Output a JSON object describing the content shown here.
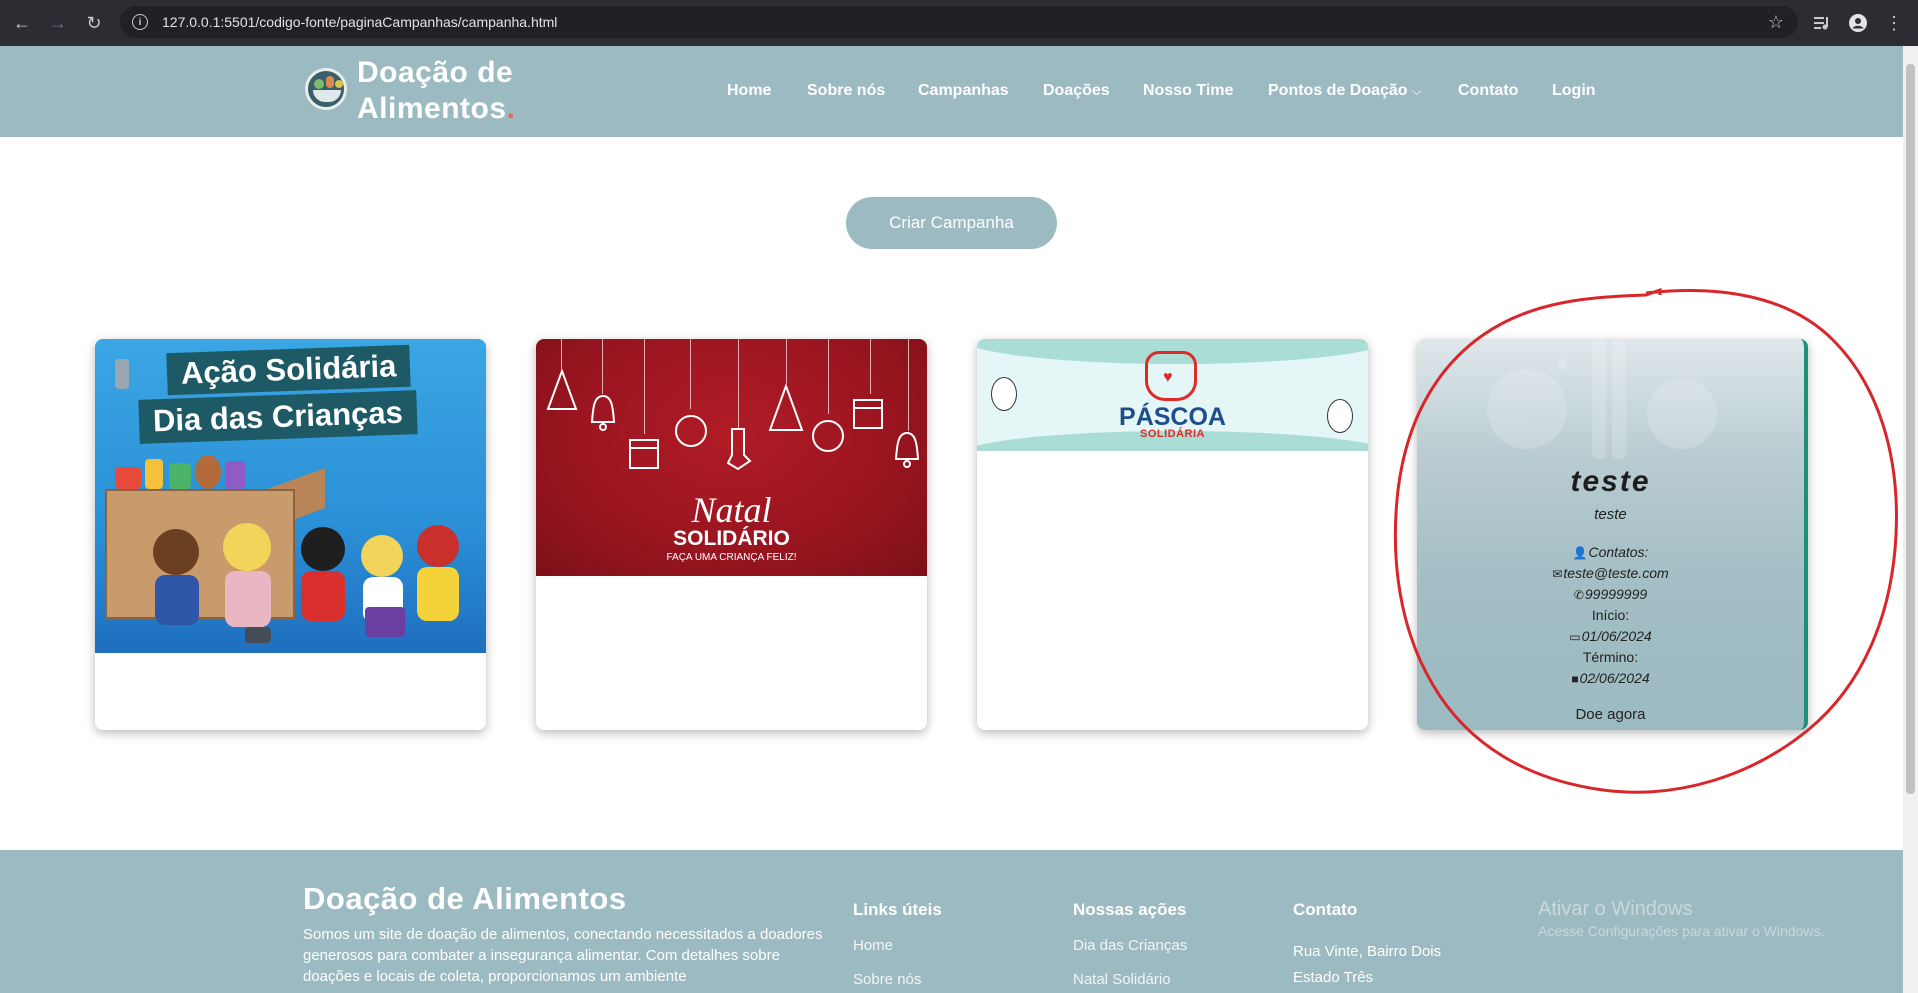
{
  "browser": {
    "url": "127.0.0.1:5501/codigo-fonte/paginaCampanhas/campanha.html",
    "back_icon": "←",
    "forward_icon": "→",
    "reload_icon": "↻",
    "info_icon": "i",
    "star_icon": "☆",
    "menu_icon": "⋮"
  },
  "header": {
    "brand_line1": "Doação de",
    "brand_line2": "Alimentos",
    "brand_dot": ".",
    "nav": [
      {
        "label": "Home"
      },
      {
        "label": "Sobre nós"
      },
      {
        "label": "Campanhas"
      },
      {
        "label": "Doações"
      },
      {
        "label": "Nosso Time"
      },
      {
        "label": "Pontos de Doação"
      },
      {
        "label": "Contato"
      },
      {
        "label": "Login"
      }
    ],
    "dropdown_icon": "⌵"
  },
  "main": {
    "create_button": "Criar Campanha",
    "cards": [
      {
        "line1": "Ação Solidária",
        "line2": "Dia das Crianças"
      },
      {
        "line1": "Natal",
        "line2": "SOLIDÁRIO",
        "line3": "FAÇA UMA CRIANÇA FELIZ!"
      },
      {
        "line1": "PÁSCOA",
        "line2": "SOLIDÁRIA"
      },
      {
        "title": "teste",
        "description": "teste",
        "contacts_label": "Contatos:",
        "email": "teste@teste.com",
        "phone": "99999999",
        "start_label": "Início:",
        "start_date": "01/06/2024",
        "end_label": "Término:",
        "end_date": "02/06/2024",
        "donate_label": "Doe agora"
      }
    ]
  },
  "footer": {
    "title": "Doação de Alimentos",
    "text": "Somos um site de doação de alimentos, conectando necessitados a doadores generosos para combater a insegurança alimentar. Com detalhes sobre doações e locais de coleta, proporcionamos um ambiente",
    "links_title": "Links úteis",
    "links": [
      "Home",
      "Sobre nós"
    ],
    "actions_title": "Nossas ações",
    "actions": [
      "Dia das Crianças",
      "Natal Solidário"
    ],
    "contact_title": "Contato",
    "contact_lines": [
      "Rua Vinte, Bairro Dois",
      "Estado Três"
    ]
  },
  "windows_watermark": {
    "line1": "Ativar o Windows",
    "line2": "Acesse Configurações para ativar o Windows."
  },
  "colors": {
    "header_bg": "#9cbac1",
    "chrome_bg": "#2b2d33",
    "annotation_red": "#d9262a",
    "card4_border": "#1f8f7a"
  }
}
